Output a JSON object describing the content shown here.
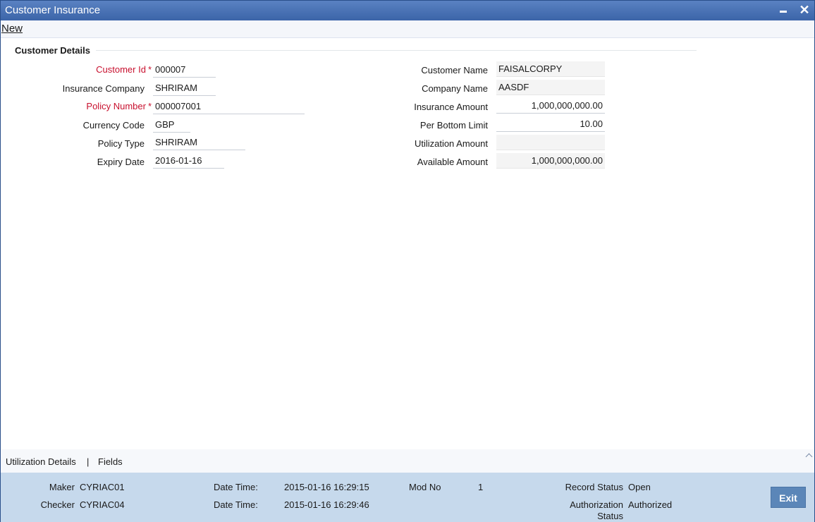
{
  "window": {
    "title": "Customer Insurance",
    "min_icon": "minimize-icon",
    "close_icon": "close-icon",
    "close_glyph": "✕"
  },
  "toolbar": {
    "new_label": "New"
  },
  "section": {
    "title": "Customer Details"
  },
  "left_fields": {
    "customer_id": {
      "label": "Customer Id",
      "value": "000007"
    },
    "insurance_company": {
      "label": "Insurance Company",
      "value": "SHRIRAM"
    },
    "policy_number": {
      "label": "Policy Number",
      "value": "000007001"
    },
    "currency_code": {
      "label": "Currency Code",
      "value": "GBP"
    },
    "policy_type": {
      "label": "Policy Type",
      "value": "SHRIRAM"
    },
    "expiry_date": {
      "label": "Expiry Date",
      "value": "2016-01-16"
    }
  },
  "right_fields": {
    "customer_name": {
      "label": "Customer Name",
      "value": "FAISALCORPY"
    },
    "company_name": {
      "label": "Company Name",
      "value": "AASDF"
    },
    "insurance_amount": {
      "label": "Insurance Amount",
      "value": "1,000,000,000.00"
    },
    "per_bottom_limit": {
      "label": "Per Bottom Limit",
      "value": "10.00"
    },
    "utilization_amount": {
      "label": "Utilization Amount",
      "value": ""
    },
    "available_amount": {
      "label": "Available Amount",
      "value": "1,000,000,000.00"
    }
  },
  "required_marker": "*",
  "tabs": {
    "utilization_details": "Utilization Details",
    "separator": "|",
    "fields": "Fields"
  },
  "footer": {
    "maker_label": "Maker",
    "maker_value": "CYRIAC01",
    "checker_label": "Checker",
    "checker_value": "CYRIAC04",
    "maker_dt_label": "Date Time:",
    "maker_dt_value": "2015-01-16 16:29:15",
    "checker_dt_label": "Date Time:",
    "checker_dt_value": "2015-01-16 16:29:46",
    "mod_no_label": "Mod No",
    "mod_no_value": "1",
    "record_status_label": "Record Status",
    "record_status_value": "Open",
    "auth_status_label_1": "Authorization",
    "auth_status_label_2": "Status",
    "auth_status_value": "Authorized",
    "exit_label": "Exit"
  },
  "colors": {
    "title_bar": "#3b64a8",
    "required": "#c8102e",
    "footer": "#c6d9ec",
    "exit_button": "#5b86b8"
  }
}
